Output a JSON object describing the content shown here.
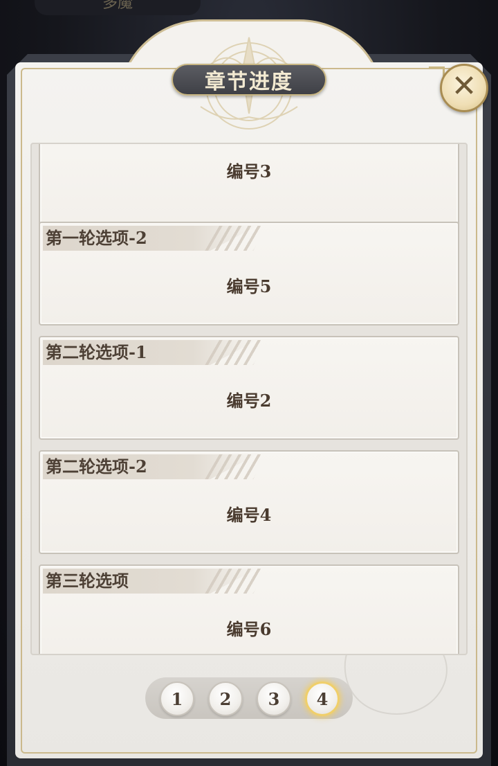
{
  "background_tab": {
    "label": "多魔"
  },
  "header": {
    "title": "章节进度"
  },
  "icons": {
    "close": "close-icon"
  },
  "cards": [
    {
      "tag": "",
      "code": "编号3"
    },
    {
      "tag": "第一轮选项-2",
      "code": "编号5"
    },
    {
      "tag": "第二轮选项-1",
      "code": "编号2"
    },
    {
      "tag": "第二轮选项-2",
      "code": "编号4"
    },
    {
      "tag": "第三轮选项",
      "code": "编号6"
    }
  ],
  "pager": {
    "pages": [
      "1",
      "2",
      "3",
      "4"
    ],
    "active_page": "4"
  },
  "colors": {
    "accent_gold": "#c9b783",
    "title_plate": "#4a4b51",
    "text_brown": "#4a3b2f",
    "active_glow": "#f0cf6a"
  }
}
